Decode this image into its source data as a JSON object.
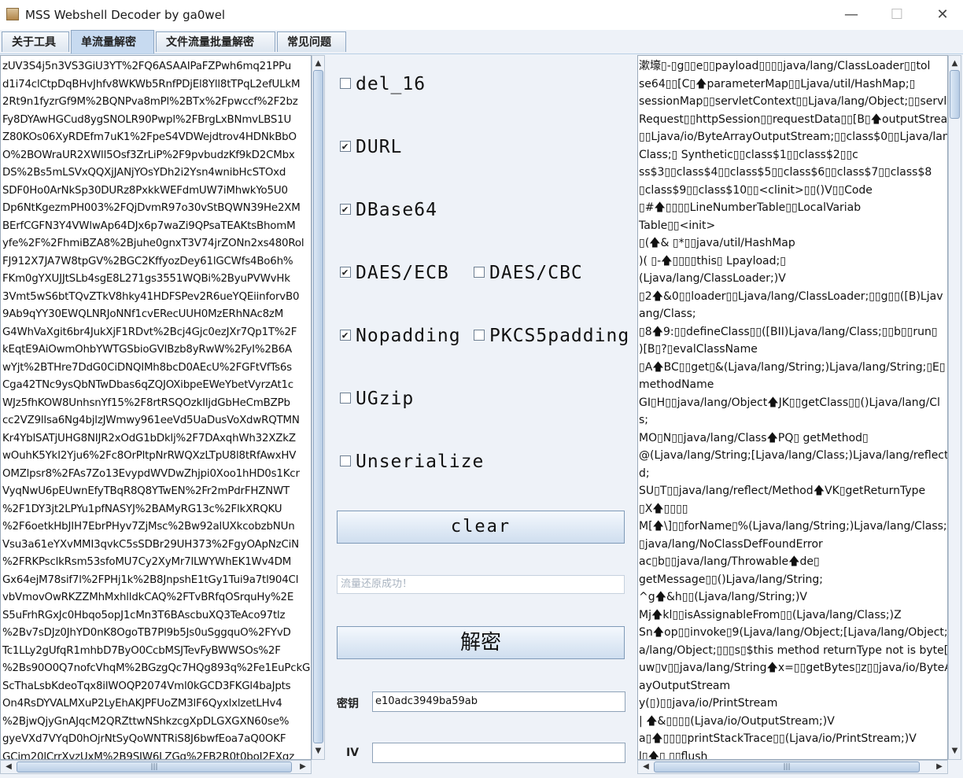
{
  "window": {
    "title": "MSS Webshell Decoder by ga0wel",
    "controls": [
      "—",
      "☐",
      "✕"
    ]
  },
  "tabs": [
    "关于工具",
    "单流量解密",
    "文件流量批量解密",
    "常见问题"
  ],
  "left_text": [
    "zUV3S4j5n3VS3GiU3YT%2FQ6ASAAIPaFZPwh6mq21PPu",
    "d1i74clCtpDqBHvJhfv8WKWb5RnfPDjEl8Yll8tTPqL2efULkM",
    "2Rt9n1fyzrGf9M%2BQNPva8mPl%2BTx%2Fpwccf%2F2bz",
    "Fy8DYAwHGCud8ygSNOLR90Pwpl%2FBrgLxBNmvLBS1U",
    "Z80KOs06XyRDEfm7uK1%2FpeS4VDWejdtrov4HDNkBbO",
    "O%2BOWraUR2XWll5Osf3ZrLiP%2F9pvbudzKf9kD2CMbx",
    "DS%2Bs5mLSVxQQXjJANjYOsYDh2i2Ysn4wnibHcSTOxd",
    "SDF0Ho0ArNkSp30DURz8PxkkWEFdmUW7iMhwkYo5U0",
    "Dp6NtKgezmPH003%2FQjDvmR97o30vStBQWN39He2XM",
    "BErfCGFN3Y4VWlwAp64DJx6p7waZi9QPsaTEAKtsBhomM",
    "yfe%2F%2FhmiBZA8%2Bjuhe0gnxT3V74jrZONn2xs480Rol",
    "FJ912X7JA7W8tpGV%2BGC2KffyozDey61lGCWfs4Bo6h%",
    "FKm0gYXUJJtSLb4sgE8L271gs3551WQBi%2ByuPVWvHk",
    "3Vmt5wS6btTQvZTkV8hky41HDFSPev2R6ueYQEiinforvB0",
    "9Ab9qYY30EWQLNRJoNNf1cvERecUUH0MzERhNAc8zM",
    "G4WhVaXgit6br4JukXjF1RDvt%2Bcj4Gjc0ezJXr7Qp1T%2F",
    "kEqtE9AiOwmOhbYWTGSbioGVIBzb8yRwW%2FyI%2B6A",
    "wYjt%2BTHre7DdG0CiDNQIMh8bcD0AEcU%2FGFtVfTs6s",
    "Cga42TNc9ysQbNTwDbas6qZQJOXibpeEWeYbetVyrzAt1c",
    "WJz5fhKOW8UnhsnYf15%2F8rtRSQOzkIljdGbHeCmBZPb",
    "cc2VZ9llsa6Ng4bjlzJWmwy961eeVd5UaDusVoXdwRQTMN",
    "Kr4YblSATjUHG8NIJR2xOdG1bDklj%2F7DAxqhWh32XZkZ",
    "wOuhK5YkI2Yju6%2Fc8OrPltpNrRWQXzLTpU8l8tRfAwxHV",
    "OMZlpsr8%2FAs7Zo13EvypdWVDwZhjpi0Xoo1hHD0s1Kcr",
    "VyqNwU6pEUwnEfyTBqR8Q8YTwEN%2Fr2mPdrFHZNWT",
    "%2F1DY3jt2LPYu1pfNASYJ%2BAMyRG13c%2FlkXRQKU",
    "%2F6oetkHbJIH7EbrPHyv7ZjMsc%2Bw92alUXkcobzbNUn",
    "Vsu3a61eYXvMMI3qvkC5sSDBr29UH373%2FgyOApNzCiN",
    "%2FRKPsclkRsm53sfoMU7Cy2XyMr7lLWYWhEK1Wv4DM",
    "Gx64ejM78sif7l%2FPHj1k%2B8JnpshE1tGy1Tui9a7tl904Cl",
    "vbVmovOwRKZZMhMxhlldkCAQ%2FTvBRfqOSrquHy%2E",
    "S5uFrhRGxJc0Hbqo5opJ1cMn3T6BAscbuXQ3TeAco97tlz",
    "%2Bv7sDJz0JhYD0nK8OgoTB7Pl9b5Js0uSggquO%2FYvD",
    "Tc1LLy2gUfqR1mhbD7ByO0CcbMSJTevFyBWWSOs%2F",
    "%2Bs90O0Q7nofcVhqM%2BGzgQc7HQg893q%2Fe1EuPckG",
    "ScThaLsbKdeoTqx8ilWOQP2074Vml0kGCD3FKGl4baJpts",
    "On4RsDYVALMXuP2LyEhAKJPFUoZM3lF6QyxlxlzetLHv4",
    "%2BjwQjyGnAJqcM2QRZttwNShkzcgXpDLGXGXN60se%",
    "gyeVXd7VYqD0hOjrNtSyQoWNTRiS8J6bwfEoa7aQ0OKF",
    "GCim20lCrrXyzUxM%2B9SJW6LZGq%2FB2R0t0boI2EXqz"
  ],
  "options": {
    "del16": {
      "label": "del_16",
      "checked": false
    },
    "durl": {
      "label": "DURL",
      "checked": true
    },
    "dbase64": {
      "label": "DBase64",
      "checked": true
    },
    "daes_ecb": {
      "label": "DAES/ECB",
      "checked": true
    },
    "daes_cbc": {
      "label": "DAES/CBC",
      "checked": false
    },
    "nopadding": {
      "label": "Nopadding",
      "checked": true
    },
    "pkcs5": {
      "label": "PKCS5padding",
      "checked": false
    },
    "ugzip": {
      "label": "UGzip",
      "checked": false
    },
    "unserialize": {
      "label": "Unserialize",
      "checked": false
    }
  },
  "buttons": {
    "clear": "clear",
    "decrypt": "解密"
  },
  "status_text": "流量还原成功！",
  "key": {
    "label": "密钥",
    "value": "e10adc3949ba59ab"
  },
  "iv": {
    "label": "IV",
    "value": ""
  },
  "right_text": [
    "漱壕▯-▯g▯▯e▯▯payload▯▯▯▯java/lang/ClassLoader▯▯tol",
    "se64▯▯[C▯🡅parameterMap▯▯Ljava/util/HashMap;▯",
    "sessionMap▯▯servletContext▯▯Ljava/lang/Object;▯▯servle",
    "Request▯▯httpSession▯▯requestData▯▯[B▯🡅outputStrear",
    "▯▯Ljava/io/ByteArrayOutputStream;▯▯class$0▯▯Ljava/lan",
    "Class;▯          Synthetic▯▯class$1▯▯class$2▯▯c",
    "ss$3▯▯class$4▯▯class$5▯▯class$6▯▯class$7▯▯class$8",
    "▯class$9▯▯class$10▯▯<clinit>▯▯()V▯▯Code",
    "          ▯#🡅▯▯▯▯LineNumberTable▯▯LocalVariab",
    "Table▯▯<init>",
    "▯(🡅& ▯*▯▯java/util/HashMap",
    ")(               ▯-🡅▯▯▯▯this▯           Lpayload;▯",
    "(Ljava/lang/ClassLoader;)V",
    "▯2🡅&0▯▯loader▯▯Ljava/lang/ClassLoader;▯▯g▯▯([B)Ljav",
    "ang/Class;",
    "▯8🡅9:▯▯defineClass▯▯([BII)Ljava/lang/Class;▯▯b▯▯run▯",
    ")[B▯?▯evalClassName",
    "▯A🡅BC▯▯get▯&(Ljava/lang/String;)Ljava/lang/String;▯E▯",
    "methodName",
    "GI▯H▯▯java/lang/Object🡅JK▯▯getClass▯▯()Ljava/lang/Cl",
    "s;",
    "MO▯N▯▯java/lang/Class🡅PQ▯               getMethod▯",
    "@(Ljava/lang/String;[Ljava/lang/Class;)Ljava/lang/reflect/Met",
    "d;",
    "SU▯T▯▯java/lang/reflect/Method🡅VK▯getReturnType",
    "            ▯X🡅▯▯▯▯",
    "M[🡅\\]▯▯forName▯%(Ljava/lang/String;)Ljava/lang/Class;▯_",
    "▯java/lang/NoClassDefFoundError",
    "ac▯b▯▯java/lang/Throwable🡅de▯",
    "getMessage▯▯()Ljava/lang/String;",
    "^g🡅&h▯▯(Ljava/lang/String;)V",
    "Mj🡅kl▯▯isAssignableFrom▯▯(Ljava/lang/Class;)Z",
    "Sn🡅op▯▯invoke▯9(Ljava/lang/Object;[Ljava/lang/Object;)Lj",
    "a/lang/Object;▯▯▯s▯$this method returnType not is byte[]",
    "uw▯v▯▯java/lang/String🡅x=▯▯getBytes▯z▯▯java/io/ByteA",
    "ayOutputStream",
    "y(▯)▯▯java/io/PrintStream",
    "|  🡅&▯▯▯▯(Ljava/io/OutputStream;)V",
    "a▯🡅▯▯▯▯printStackTrace▯▯(Ljava/io/PrintStream;)V",
    "l▯🡅▯ ▯▯flush"
  ],
  "colors": {
    "accent": "#c7daf0",
    "window_bg": "#eef2f8",
    "status_text": "#a8b3c0"
  }
}
